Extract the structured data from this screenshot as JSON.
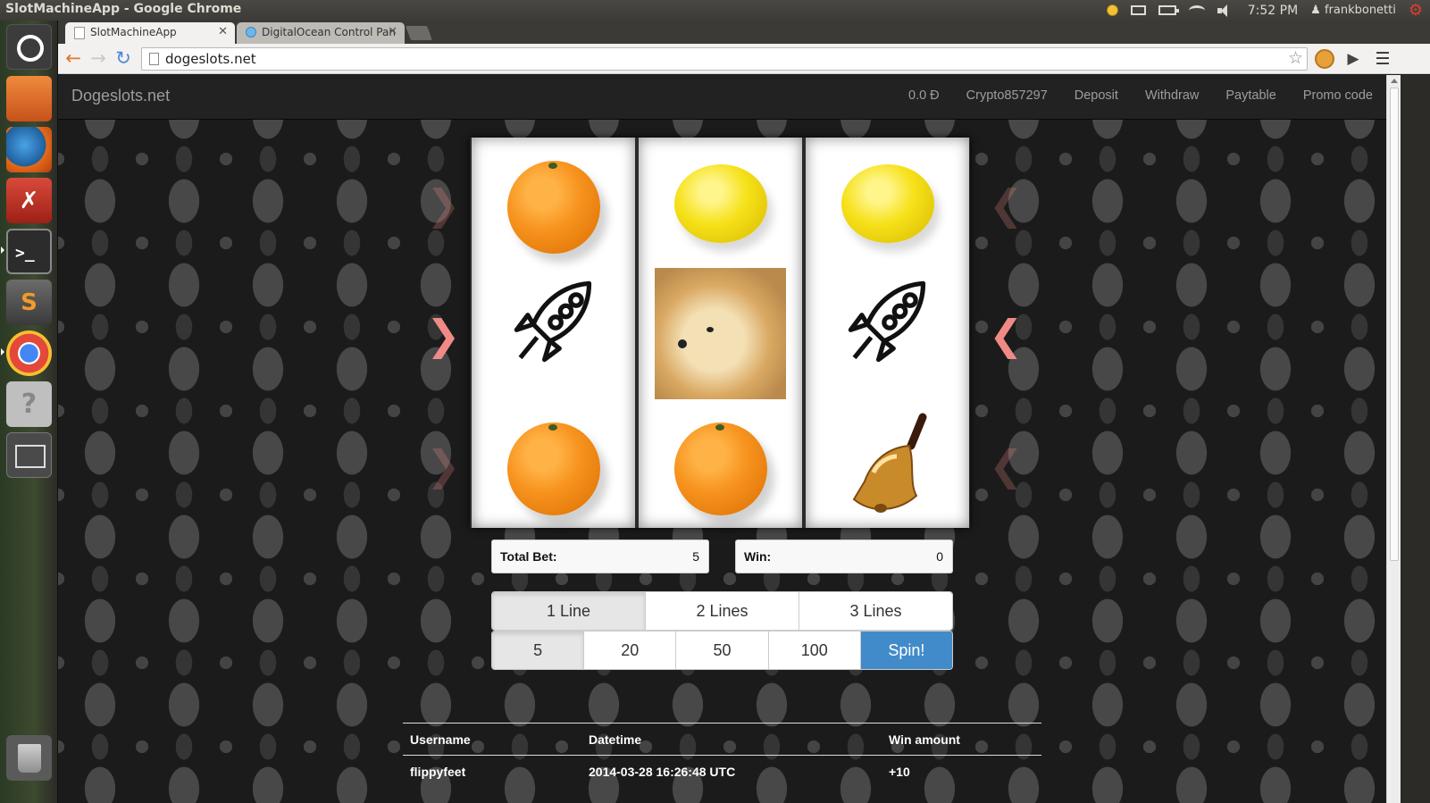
{
  "os": {
    "window_title": "SlotMachineApp - Google Chrome",
    "clock": "7:52 PM",
    "user": "frankbonetti"
  },
  "browser": {
    "tabs": [
      {
        "label": "SlotMachineApp",
        "active": true
      },
      {
        "label": "DigitalOcean Control Pan",
        "active": false
      }
    ],
    "url": "dogeslots.net"
  },
  "site": {
    "brand": "Dogeslots.net",
    "nav": {
      "balance": "0.0 Ð",
      "account": "Crypto857297",
      "deposit": "Deposit",
      "withdraw": "Withdraw",
      "paytable": "Paytable",
      "promo": "Promo code"
    }
  },
  "reels": [
    {
      "top": "orange",
      "middle": "rocket",
      "bottom": "orange"
    },
    {
      "top": "lemon",
      "middle": "doge",
      "bottom": "orange"
    },
    {
      "top": "lemon",
      "middle": "rocket",
      "bottom": "bell"
    }
  ],
  "stats": {
    "total_bet_label": "Total Bet:",
    "total_bet_value": "5",
    "win_label": "Win:",
    "win_value": "0"
  },
  "lines": {
    "options": [
      "1 Line",
      "2 Lines",
      "3 Lines"
    ],
    "selected": "1 Line"
  },
  "bets": {
    "options": [
      "5",
      "20",
      "50",
      "100"
    ],
    "selected": "5",
    "spin_label": "Spin!"
  },
  "winners": {
    "headers": {
      "username": "Username",
      "datetime": "Datetime",
      "amount": "Win amount"
    },
    "rows": [
      {
        "username": "flippyfeet",
        "datetime": "2014-03-28 16:26:48 UTC",
        "amount": "+10"
      }
    ]
  },
  "colors": {
    "spin_button": "#428bca",
    "arrow": "#f08a86",
    "navbar": "#222222"
  }
}
